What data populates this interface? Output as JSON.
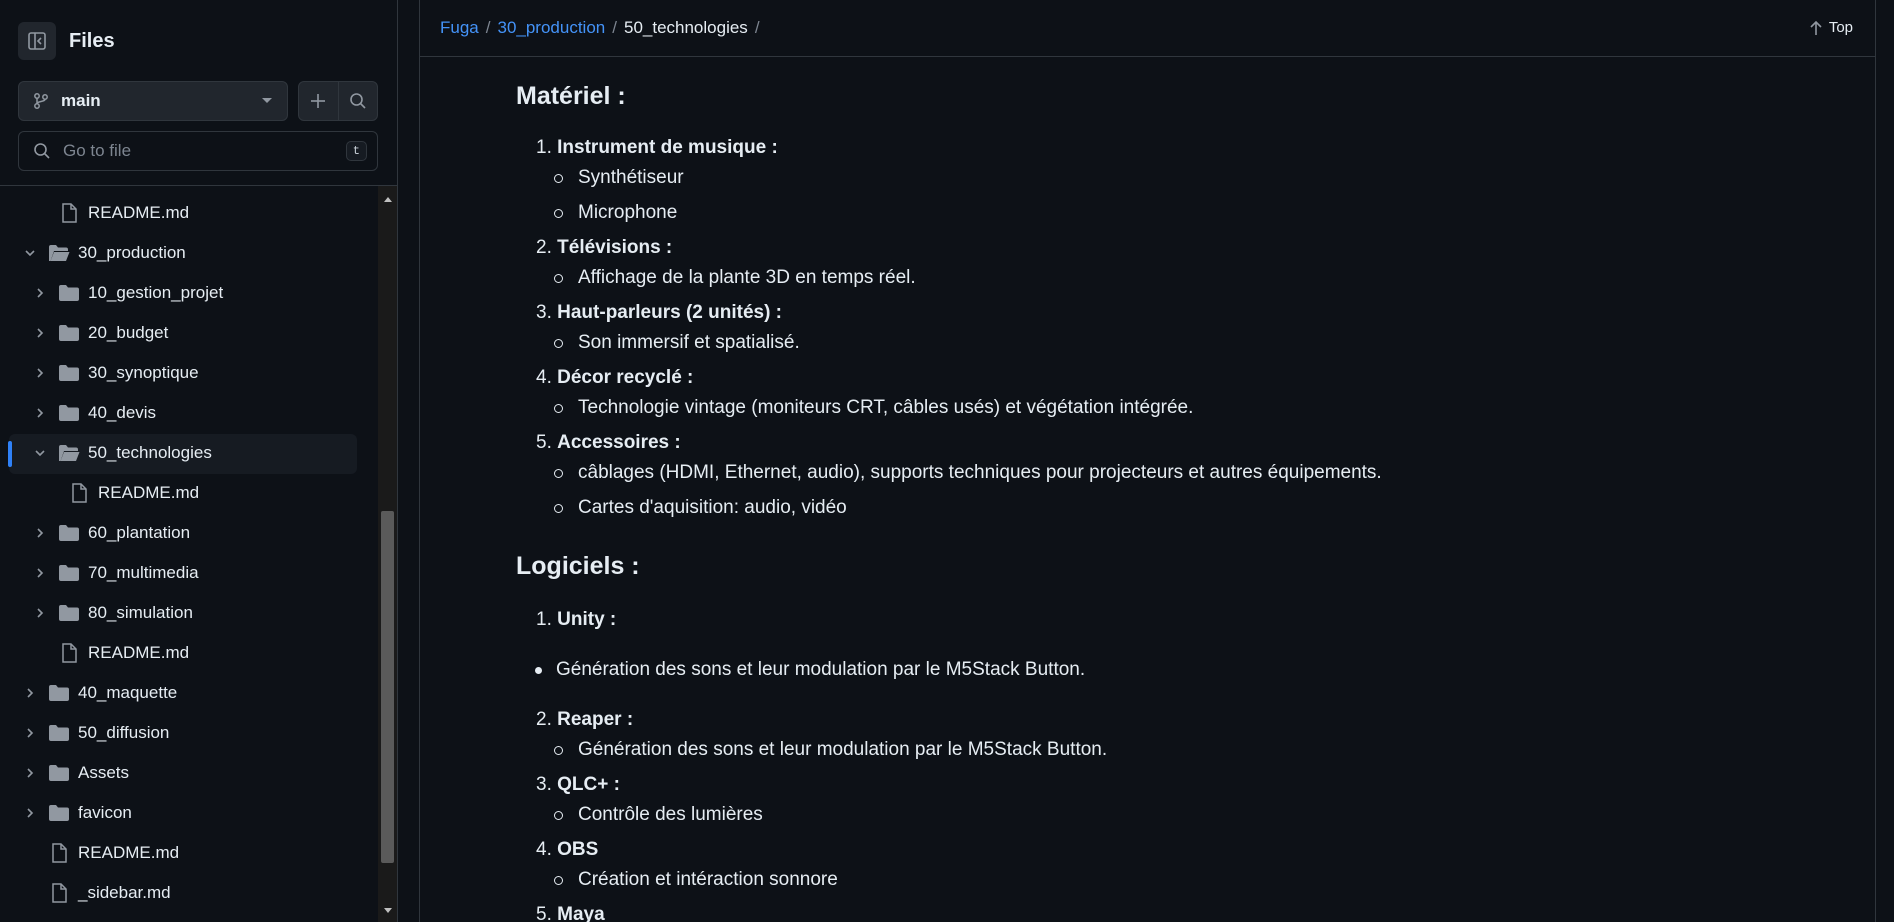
{
  "sidebar": {
    "title": "Files",
    "branch": "main",
    "goto_placeholder": "Go to file",
    "goto_shortcut": "t",
    "tree": [
      {
        "label": "README.md",
        "kind": "file",
        "depth": 1
      },
      {
        "label": "30_production",
        "kind": "folder",
        "depth": 0,
        "expanded": true
      },
      {
        "label": "10_gestion_projet",
        "kind": "folder",
        "depth": 1
      },
      {
        "label": "20_budget",
        "kind": "folder",
        "depth": 1
      },
      {
        "label": "30_synoptique",
        "kind": "folder",
        "depth": 1
      },
      {
        "label": "40_devis",
        "kind": "folder",
        "depth": 1
      },
      {
        "label": "50_technologies",
        "kind": "folder",
        "depth": 1,
        "expanded": true,
        "selected": true
      },
      {
        "label": "README.md",
        "kind": "file",
        "depth": 2
      },
      {
        "label": "60_plantation",
        "kind": "folder",
        "depth": 1
      },
      {
        "label": "70_multimedia",
        "kind": "folder",
        "depth": 1
      },
      {
        "label": "80_simulation",
        "kind": "folder",
        "depth": 1
      },
      {
        "label": "README.md",
        "kind": "file",
        "depth": 1
      },
      {
        "label": "40_maquette",
        "kind": "folder",
        "depth": 0
      },
      {
        "label": "50_diffusion",
        "kind": "folder",
        "depth": 0
      },
      {
        "label": "Assets",
        "kind": "folder",
        "depth": 0
      },
      {
        "label": "favicon",
        "kind": "folder",
        "depth": 0
      },
      {
        "label": "README.md",
        "kind": "file",
        "depth": 0
      },
      {
        "label": "_sidebar.md",
        "kind": "file",
        "depth": 0
      }
    ]
  },
  "breadcrumb": {
    "root": "Fuga",
    "parent": "30_production",
    "current": "50_technologies",
    "sep": "/",
    "trailing": "/"
  },
  "top_link": "Top",
  "content": {
    "materiel": {
      "heading": "Matériel :",
      "items": [
        {
          "num": "1.",
          "title": "Instrument de musique :",
          "subs": [
            "Synthétiseur",
            "Microphone"
          ]
        },
        {
          "num": "2.",
          "title": "Télévisions :",
          "subs": [
            "Affichage de la plante 3D en temps réel."
          ]
        },
        {
          "num": "3.",
          "title": "Haut-parleurs (2 unités) :",
          "subs": [
            "Son immersif et spatialisé."
          ]
        },
        {
          "num": "4.",
          "title": "Décor recyclé :",
          "subs": [
            "Technologie vintage (moniteurs CRT, câbles usés) et végétation intégrée."
          ]
        },
        {
          "num": "5.",
          "title": "Accessoires :",
          "subs": [
            "câblages (HDMI, Ethernet, audio), supports techniques pour projecteurs et autres équipements.",
            "Cartes d'aquisition: audio, vidéo"
          ]
        }
      ]
    },
    "logiciels": {
      "heading": "Logiciels :",
      "unity": {
        "num": "1.",
        "title": "Unity :"
      },
      "bullet": "Génération des sons et leur modulation par le M5Stack Button.",
      "items": [
        {
          "num": "2.",
          "title": "Reaper :",
          "subs": [
            "Génération des sons et leur modulation par le M5Stack Button."
          ]
        },
        {
          "num": "3.",
          "title": "QLC+ :",
          "subs": [
            "Contrôle des lumières"
          ]
        },
        {
          "num": "4.",
          "title": "OBS",
          "subs": [
            "Création et intéraction sonnore"
          ]
        },
        {
          "num": "5.",
          "title": "Maya",
          "subs": []
        }
      ]
    }
  }
}
